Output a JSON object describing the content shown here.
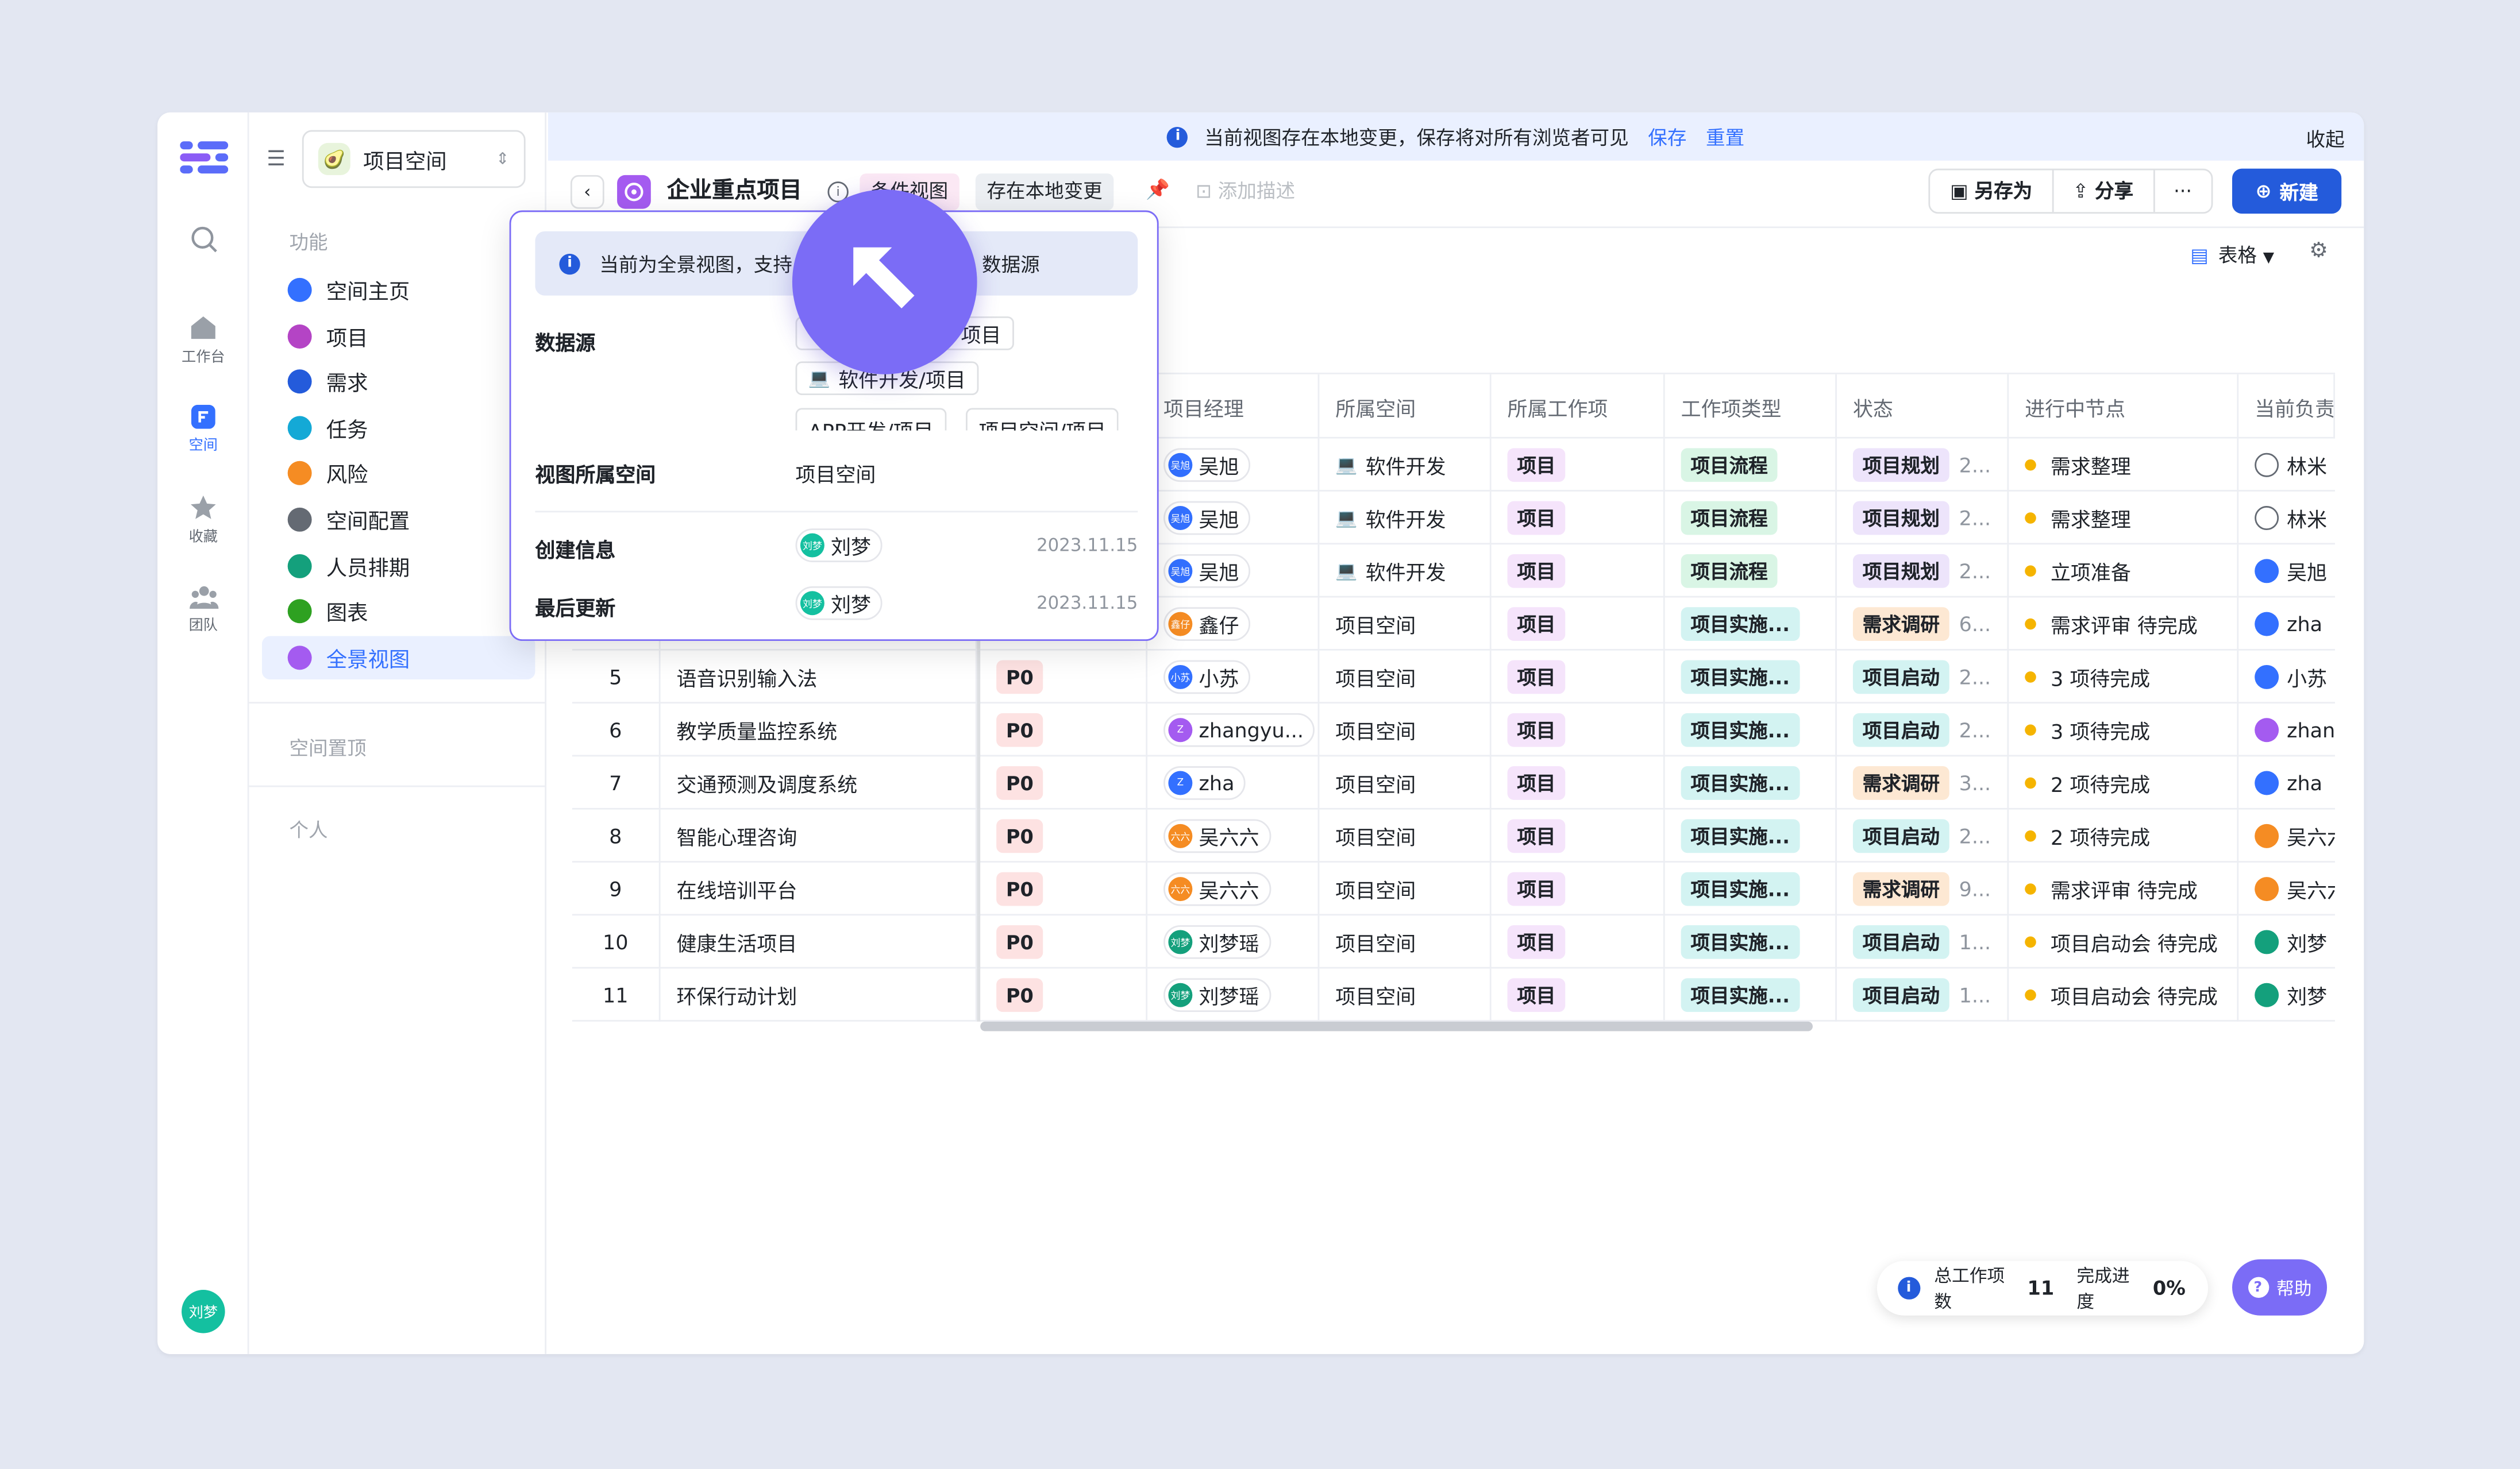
{
  "banner": {
    "message": "当前视图存在本地变更，保存将对所有浏览者可见",
    "save": "保存",
    "reset": "重置",
    "collapse": "收起"
  },
  "rail": {
    "items": [
      {
        "label": "工作台"
      },
      {
        "label": "空间"
      },
      {
        "label": "收藏"
      },
      {
        "label": "团队"
      }
    ],
    "user_avatar": "刘梦"
  },
  "sidebar": {
    "workspace": "项目空间",
    "section_features": "功能",
    "items": [
      {
        "label": "空间主页",
        "color": "#3370ff"
      },
      {
        "label": "项目",
        "color": "#b444c5"
      },
      {
        "label": "需求",
        "color": "#245bdb"
      },
      {
        "label": "任务",
        "color": "#14a9d6"
      },
      {
        "label": "风险",
        "color": "#f58c23"
      },
      {
        "label": "空间配置",
        "color": "#646a73"
      },
      {
        "label": "人员排期",
        "color": "#14a07c"
      },
      {
        "label": "图表",
        "color": "#2ea121"
      },
      {
        "label": "全景视图",
        "color": "#a45bf0"
      }
    ],
    "section_pinned": "空间置顶",
    "section_personal": "个人"
  },
  "toolbar": {
    "title": "企业重点项目",
    "tag_pink": "条件视图",
    "tag_local": "存在本地变更",
    "add_desc": "添加描述",
    "save_as": "另存为",
    "share": "分享",
    "more": "···",
    "new": "新建"
  },
  "view_switch": {
    "label": "表格"
  },
  "table": {
    "headers": [
      "项目经理",
      "所属空间",
      "所属工作项",
      "工作项类型",
      "状态",
      "进行中节点",
      "当前负责"
    ],
    "rows": [
      {
        "num": "",
        "name": "",
        "priority": "",
        "pm": "吴旭",
        "pm_av": "吴旭",
        "pm_color": "#3370ff",
        "space": "软件开发",
        "space_laptop": true,
        "item": "项目",
        "type": "项目流程",
        "type_cls": "c-lc",
        "status": "项目规划",
        "status_cls": "c-gh",
        "extra": "2...",
        "node": "需求整理",
        "owner": "林米",
        "owner_color": "#ffffff"
      },
      {
        "num": "",
        "name": "",
        "priority": "",
        "pm": "吴旭",
        "pm_av": "吴旭",
        "pm_color": "#3370ff",
        "space": "软件开发",
        "space_laptop": true,
        "item": "项目",
        "type": "项目流程",
        "type_cls": "c-lc",
        "status": "项目规划",
        "status_cls": "c-gh",
        "extra": "2...",
        "node": "需求整理",
        "owner": "林米",
        "owner_color": "#ffffff"
      },
      {
        "num": "",
        "name": "",
        "priority": "",
        "pm": "吴旭",
        "pm_av": "吴旭",
        "pm_color": "#3370ff",
        "space": "软件开发",
        "space_laptop": true,
        "item": "项目",
        "type": "项目流程",
        "type_cls": "c-lc",
        "status": "项目规划",
        "status_cls": "c-gh",
        "extra": "2...",
        "node": "立项准备",
        "owner": "吴旭",
        "owner_color": "#3370ff"
      },
      {
        "num": "",
        "name": "",
        "priority": "",
        "pm": "鑫仔",
        "pm_av": "鑫仔",
        "pm_color": "#f58c23",
        "space": "项目空间",
        "space_laptop": false,
        "item": "项目",
        "type": "项目实施...",
        "type_cls": "c-ss",
        "status": "需求调研",
        "status_cls": "c-dy",
        "extra": "6...",
        "node": "需求评审 待完成",
        "owner": "zha",
        "owner_color": "#3370ff"
      },
      {
        "num": "5",
        "name": "语音识别输入法",
        "priority": "P0",
        "pm": "小苏",
        "pm_av": "小苏",
        "pm_color": "#3370ff",
        "space": "项目空间",
        "space_laptop": false,
        "item": "项目",
        "type": "项目实施...",
        "type_cls": "c-ss",
        "status": "项目启动",
        "status_cls": "c-qd",
        "extra": "2...",
        "node": "3 项待完成",
        "owner": "小苏",
        "owner_color": "#3370ff"
      },
      {
        "num": "6",
        "name": "教学质量监控系统",
        "priority": "P0",
        "pm": "zhangyu...",
        "pm_av": "Z",
        "pm_color": "#a45bf0",
        "space": "项目空间",
        "space_laptop": false,
        "item": "项目",
        "type": "项目实施...",
        "type_cls": "c-ss",
        "status": "项目启动",
        "status_cls": "c-qd",
        "extra": "2...",
        "node": "3 项待完成",
        "owner": "zhan",
        "owner_color": "#a45bf0"
      },
      {
        "num": "7",
        "name": "交通预测及调度系统",
        "priority": "P0",
        "pm": "zha",
        "pm_av": "Z",
        "pm_color": "#3370ff",
        "space": "项目空间",
        "space_laptop": false,
        "item": "项目",
        "type": "项目实施...",
        "type_cls": "c-ss",
        "status": "需求调研",
        "status_cls": "c-dy",
        "extra": "3...",
        "node": "2 项待完成",
        "owner": "zha",
        "owner_color": "#3370ff"
      },
      {
        "num": "8",
        "name": "智能心理咨询",
        "priority": "P0",
        "pm": "吴六六",
        "pm_av": "六六",
        "pm_color": "#f58c23",
        "space": "项目空间",
        "space_laptop": false,
        "item": "项目",
        "type": "项目实施...",
        "type_cls": "c-ss",
        "status": "项目启动",
        "status_cls": "c-qd",
        "extra": "2...",
        "node": "2 项待完成",
        "owner": "吴六六",
        "owner_color": "#f58c23"
      },
      {
        "num": "9",
        "name": "在线培训平台",
        "priority": "P0",
        "pm": "吴六六",
        "pm_av": "六六",
        "pm_color": "#f58c23",
        "space": "项目空间",
        "space_laptop": false,
        "item": "项目",
        "type": "项目实施...",
        "type_cls": "c-ss",
        "status": "需求调研",
        "status_cls": "c-dy",
        "extra": "9...",
        "node": "需求评审 待完成",
        "owner": "吴六六",
        "owner_color": "#f58c23"
      },
      {
        "num": "10",
        "name": "健康生活项目",
        "priority": "P0",
        "pm": "刘梦瑶",
        "pm_av": "刘梦",
        "pm_color": "#14a07c",
        "space": "项目空间",
        "space_laptop": false,
        "item": "项目",
        "type": "项目实施...",
        "type_cls": "c-ss",
        "status": "项目启动",
        "status_cls": "c-qd",
        "extra": "1...",
        "node": "项目启动会 待完成",
        "owner": "刘梦",
        "owner_color": "#14a07c"
      },
      {
        "num": "11",
        "name": "环保行动计划",
        "priority": "P0",
        "pm": "刘梦瑶",
        "pm_av": "刘梦",
        "pm_color": "#14a07c",
        "space": "项目空间",
        "space_laptop": false,
        "item": "项目",
        "type": "项目实施...",
        "type_cls": "c-ss",
        "status": "项目启动",
        "status_cls": "c-qd",
        "extra": "1...",
        "node": "项目启动会 待完成",
        "owner": "刘梦",
        "owner_color": "#14a07c"
      }
    ]
  },
  "popover": {
    "notice_pre": "当前为全景视图，支持",
    "notice_post": "数据源",
    "datasource_label": "数据源",
    "sources": [
      "项目",
      "软件开发/项目",
      "APP开发/项目",
      "项目空间/项目"
    ],
    "space_label": "视图所属空间",
    "space_value": "项目空间",
    "created_label": "创建信息",
    "created_user": "刘梦",
    "created_date": "2023.11.15",
    "updated_label": "最后更新",
    "updated_user": "刘梦",
    "updated_date": "2023.11.15"
  },
  "footer": {
    "total_label": "总工作项数",
    "total_value": "11",
    "progress_label": "完成进度",
    "progress_value": "0%",
    "help": "帮助"
  }
}
